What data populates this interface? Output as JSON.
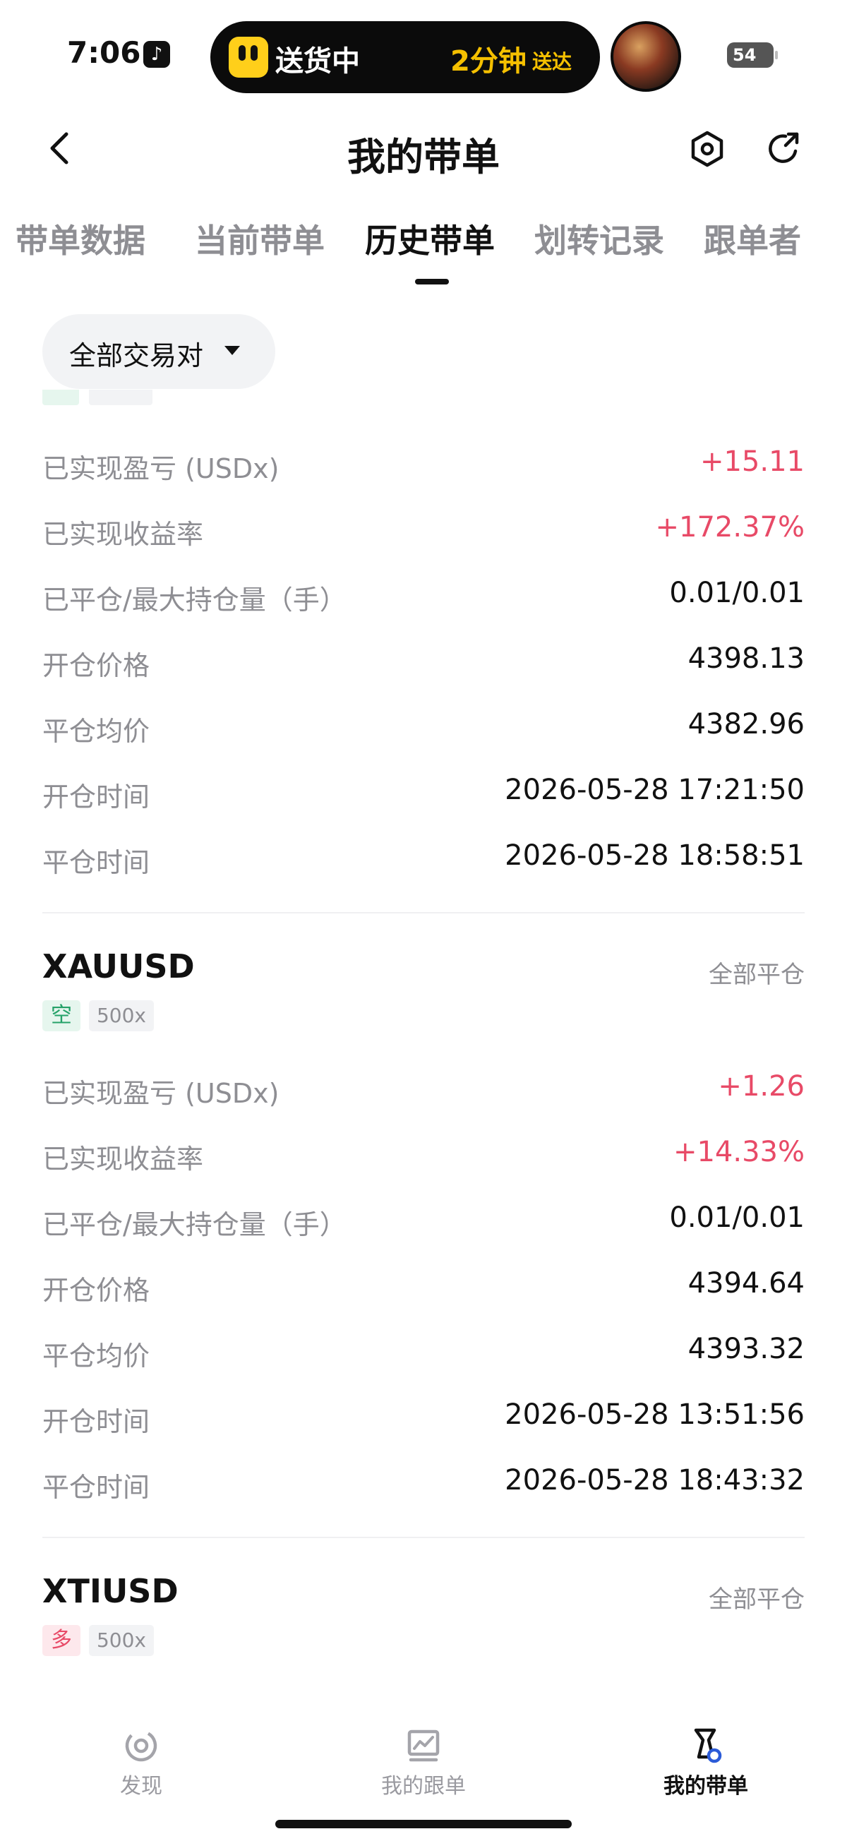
{
  "status_bar": {
    "time": "7:06",
    "island_text": "送货中",
    "island_time": "2分钟",
    "island_sub": "送达",
    "battery": "54"
  },
  "nav": {
    "title": "我的带单"
  },
  "tabs": [
    {
      "label": "带单数据"
    },
    {
      "label": "当前带单"
    },
    {
      "label": "历史带单",
      "active": true
    },
    {
      "label": "划转记录"
    },
    {
      "label": "跟单者"
    }
  ],
  "filter": {
    "label": "全部交易对"
  },
  "labels": {
    "realized_pnl": "已实现盈亏 (USDx)",
    "realized_rate": "已实现收益率",
    "closed_max": "已平仓/最大持仓量（手）",
    "open_price": "开仓价格",
    "close_avg": "平仓均价",
    "open_time": "开仓时间",
    "close_time": "平仓时间"
  },
  "orders": [
    {
      "realized_pnl": "+15.11",
      "realized_rate": "+172.37%",
      "closed_max": "0.01/0.01",
      "open_price": "4398.13",
      "close_avg": "4382.96",
      "open_time": "2026-05-28 17:21:50",
      "close_time": "2026-05-28 18:58:51"
    },
    {
      "symbol": "XAUUSD",
      "status": "全部平仓",
      "direction": "空",
      "leverage": "500x",
      "realized_pnl": "+1.26",
      "realized_rate": "+14.33%",
      "closed_max": "0.01/0.01",
      "open_price": "4394.64",
      "close_avg": "4393.32",
      "open_time": "2026-05-28 13:51:56",
      "close_time": "2026-05-28 18:43:32"
    },
    {
      "symbol": "XTIUSD",
      "status": "全部平仓",
      "direction": "多",
      "leverage": "500x"
    }
  ],
  "bottom_nav": [
    {
      "label": "发现",
      "icon": "discover-icon"
    },
    {
      "label": "我的跟单",
      "icon": "chart-card-icon"
    },
    {
      "label": "我的带单",
      "icon": "lead-trade-icon",
      "active": true
    }
  ],
  "colors": {
    "profit": "#e84a67",
    "short_tag": "#26a269",
    "long_tag": "#e84a67",
    "muted": "#8e8e93"
  }
}
